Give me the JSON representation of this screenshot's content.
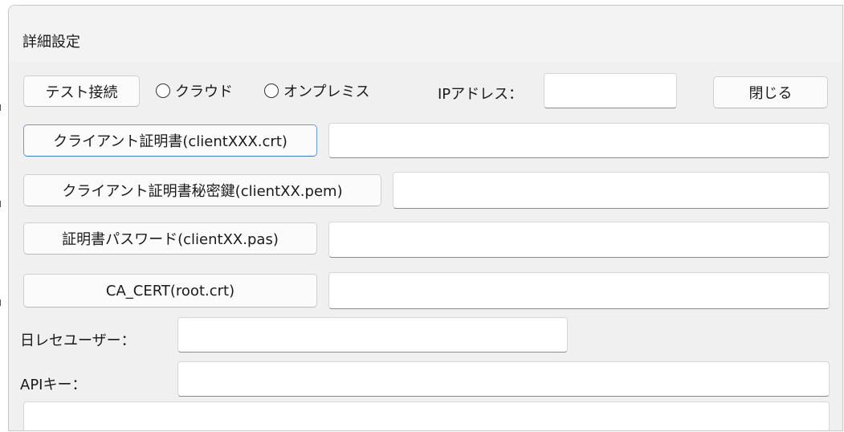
{
  "window": {
    "title": "詳細設定"
  },
  "toolbar": {
    "test_connection_label": "テスト接続",
    "radio_cloud_label": "クラウド",
    "radio_onpremise_label": "オンプレミス",
    "ip_address_label": "IPアドレス：",
    "ip_address_value": "",
    "close_label": "閉じる"
  },
  "rows": [
    {
      "button_label": "クライアント証明書(clientXXX.crt)",
      "value": ""
    },
    {
      "button_label": "クライアント証明書秘密鍵(clientXX.pem)",
      "value": ""
    },
    {
      "button_label": "証明書パスワード(clientXX.pas)",
      "value": ""
    },
    {
      "button_label": "CA_CERT(root.crt)",
      "value": ""
    }
  ],
  "fields": {
    "nichirese_user_label": "日レセユーザー：",
    "nichirese_user_value": "",
    "api_key_label": "APIキー：",
    "api_key_value": "",
    "bottom_value": ""
  }
}
